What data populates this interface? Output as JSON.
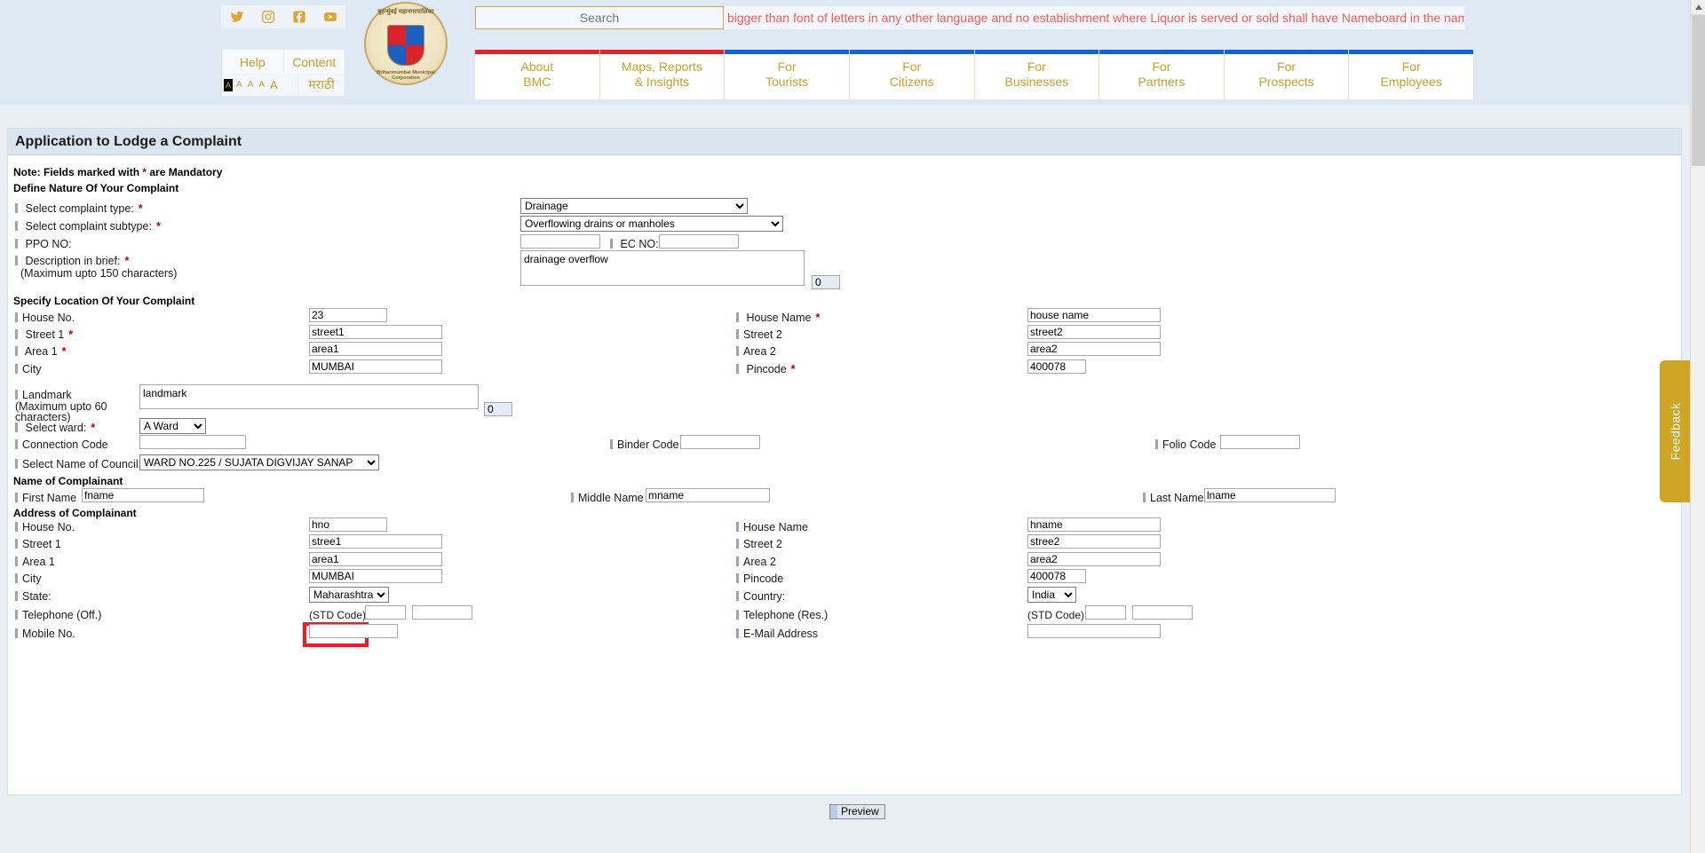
{
  "header": {
    "social": [
      {
        "name": "twitter-icon",
        "label": "Twitter"
      },
      {
        "name": "instagram-icon",
        "label": "Instagram"
      },
      {
        "name": "facebook-icon",
        "label": "Facebook"
      },
      {
        "name": "youtube-icon",
        "label": "YouTube"
      }
    ],
    "help_label": "Help",
    "content_label": "Content",
    "font_sizes": [
      "A",
      "A",
      "A",
      "A",
      "A"
    ],
    "font_size_active_index": 0,
    "language_toggle": "मराठी",
    "logo": {
      "top_text": "बृहन्मुंबई महानगरपालिका",
      "bottom_text": "Brihanmumbai Municipal Corporation"
    },
    "search_placeholder": "Search",
    "search_value": "",
    "ticker_text": "bigger than font of letters in any other language and no establishment where Liquor is served or sold shall have Nameboard in the nam",
    "nav": [
      {
        "line1": "About",
        "line2": "BMC",
        "accent": "#e4242b"
      },
      {
        "line1": "Maps, Reports",
        "line2": "& Insights",
        "accent": "#e4242b"
      },
      {
        "line1": "For",
        "line2": "Tourists",
        "accent": "#1462d6"
      },
      {
        "line1": "For",
        "line2": "Citizens",
        "accent": "#1462d6"
      },
      {
        "line1": "For",
        "line2": "Businesses",
        "accent": "#1462d6"
      },
      {
        "line1": "For",
        "line2": "Partners",
        "accent": "#1462d6"
      },
      {
        "line1": "For",
        "line2": "Prospects",
        "accent": "#1462d6"
      },
      {
        "line1": "For",
        "line2": "Employees",
        "accent": "#1462d6"
      }
    ]
  },
  "panel": {
    "title": "Application to Lodge a Complaint",
    "note_prefix": "Note: Fields marked with ",
    "note_star": "*",
    "note_suffix": " are Mandatory",
    "sections": {
      "nature": "Define Nature Of Your Complaint",
      "location": "Specify Location Of Your Complaint",
      "name": "Name of Complainant",
      "address": "Address of Complainant"
    }
  },
  "nature": {
    "complaint_type_label": "Select complaint type:",
    "complaint_type_value": "Drainage",
    "complaint_subtype_label": "Select complaint subtype:",
    "complaint_subtype_value": "Overflowing drains or manholes",
    "ppo_label": "PPO NO:",
    "ppo_value": "",
    "ec_label": "EC NO:",
    "ec_value": "",
    "description_label": "Description in brief:",
    "description_hint": "(Maximum upto 150 characters)",
    "description_value": "drainage overflow",
    "description_counter": "0"
  },
  "location": {
    "house_no_label": "House No.",
    "house_no_value": "23",
    "house_name_label": "House Name",
    "house_name_value": "house name",
    "street1_label": "Street 1",
    "street1_value": "street1",
    "street2_label": "Street 2",
    "street2_value": "street2",
    "area1_label": "Area 1",
    "area1_value": "area1",
    "area2_label": "Area 2",
    "area2_value": "area2",
    "city_label": "City",
    "city_value": "MUMBAI",
    "pincode_label": "Pincode",
    "pincode_value": "400078",
    "landmark_label": "Landmark",
    "landmark_hint_1": "(Maximum upto 60",
    "landmark_hint_2": "characters)",
    "landmark_value": "landmark",
    "landmark_counter": "0",
    "ward_label": "Select ward:",
    "ward_value": "A Ward",
    "connection_code_label": "Connection Code",
    "connection_code_value": "",
    "binder_code_label": "Binder Code",
    "binder_code_value": "",
    "folio_code_label": "Folio Code",
    "folio_code_value": "",
    "council_label": "Select Name of Council:",
    "council_value": "WARD NO.225 / SUJATA DIGVIJAY SANAP"
  },
  "complainant": {
    "first_name_label": "First Name",
    "first_name_value": "fname",
    "middle_name_label": "Middle Name",
    "middle_name_value": "mname",
    "last_name_label": "Last Name",
    "last_name_value": "lname"
  },
  "address": {
    "house_no_label": "House No.",
    "house_no_value": "hno",
    "house_name_label": "House Name",
    "house_name_value": "hname",
    "street1_label": "Street 1",
    "street1_value": "stree1",
    "street2_label": "Street 2",
    "street2_value": "stree2",
    "area1_label": "Area 1",
    "area1_value": "area1",
    "area2_label": "Area 2",
    "area2_value": "area2",
    "city_label": "City",
    "city_value": "MUMBAI",
    "pincode_label": "Pincode",
    "pincode_value": "400078",
    "state_label": "State:",
    "state_value": "Maharashtra",
    "country_label": "Country:",
    "country_value": "India",
    "tel_off_label": "Telephone (Off.)",
    "tel_off_std_label": "(STD Code)",
    "tel_off_std_value": "",
    "tel_off_value": "",
    "tel_res_label": "Telephone (Res.)",
    "tel_res_std_label": "(STD Code)",
    "tel_res_std_value": "",
    "tel_res_value": "",
    "mobile_label": "Mobile No.",
    "mobile_value": "",
    "email_label": "E-Mail Address",
    "email_value": ""
  },
  "actions": {
    "preview_label": "Preview",
    "feedback_label": "Feedback"
  }
}
